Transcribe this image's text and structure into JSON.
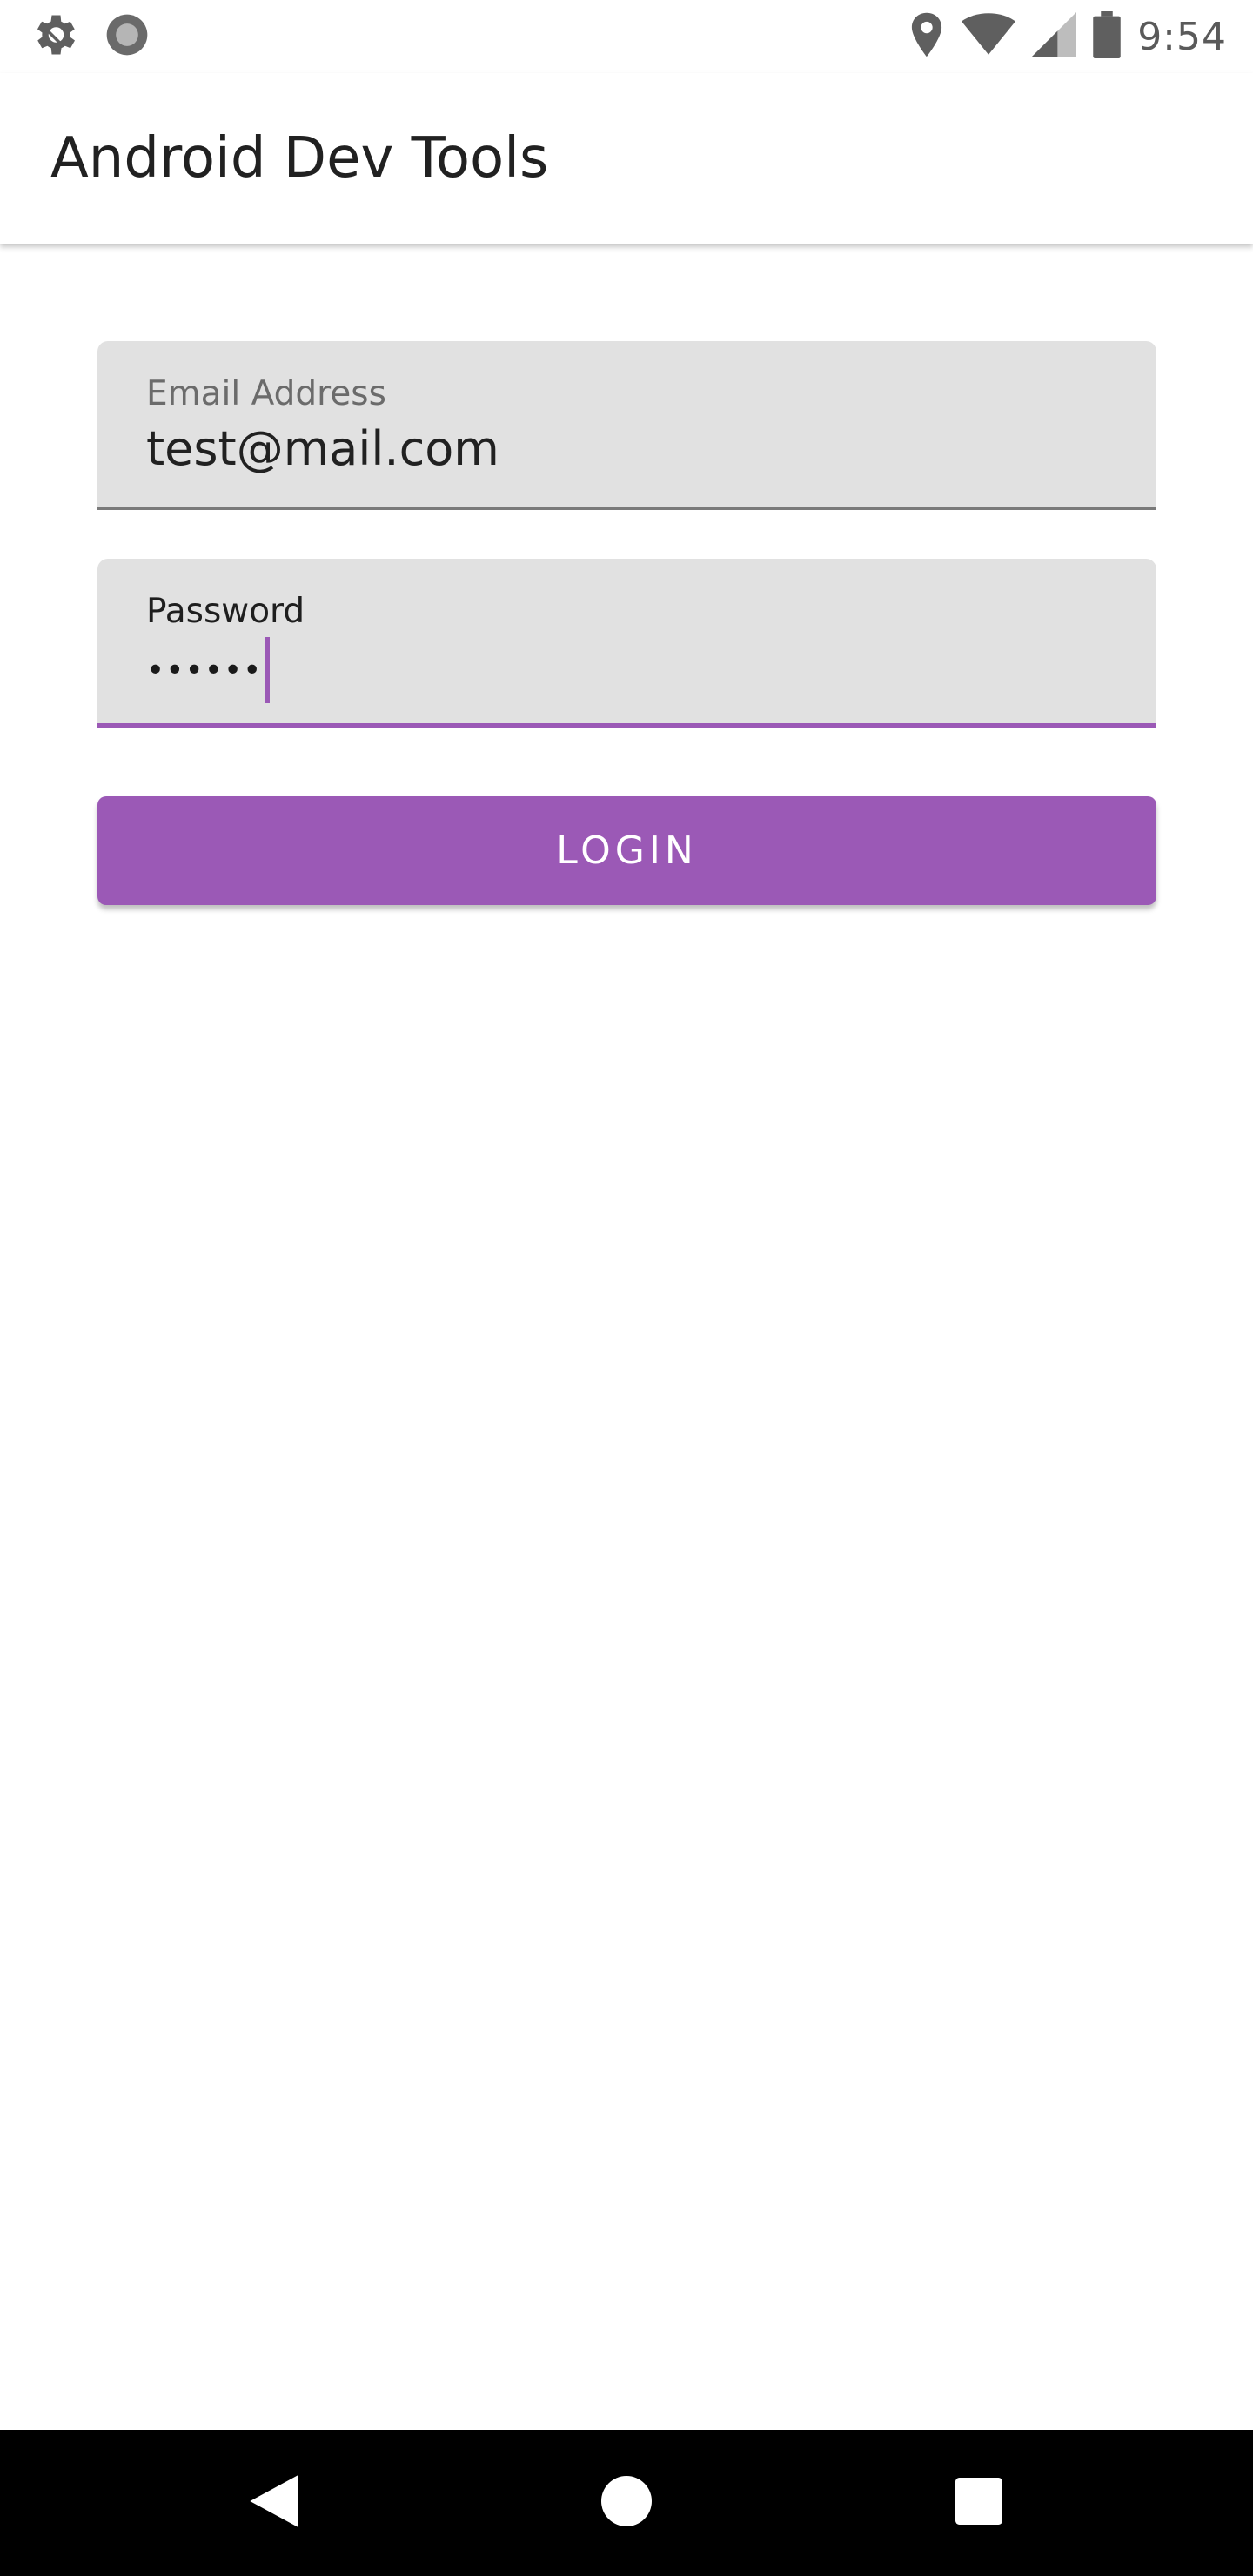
{
  "status_bar": {
    "time": "9:54",
    "icons_left": [
      "settings-gear-icon",
      "record-circle-icon"
    ],
    "icons_right": [
      "location-pin-icon",
      "wifi-icon",
      "signal-icon",
      "battery-icon"
    ]
  },
  "app_bar": {
    "title": "Android Dev Tools"
  },
  "form": {
    "email": {
      "label": "Email Address",
      "value": "test@mail.com"
    },
    "password": {
      "label": "Password",
      "value": "••••••"
    },
    "login_label": "LOGIN"
  },
  "nav_bar": {
    "buttons": [
      "back-icon",
      "home-icon",
      "recents-icon"
    ]
  },
  "colors": {
    "accent": "#9b59b6",
    "field_bg": "#e1e1e1",
    "nav_bg": "#000000"
  }
}
